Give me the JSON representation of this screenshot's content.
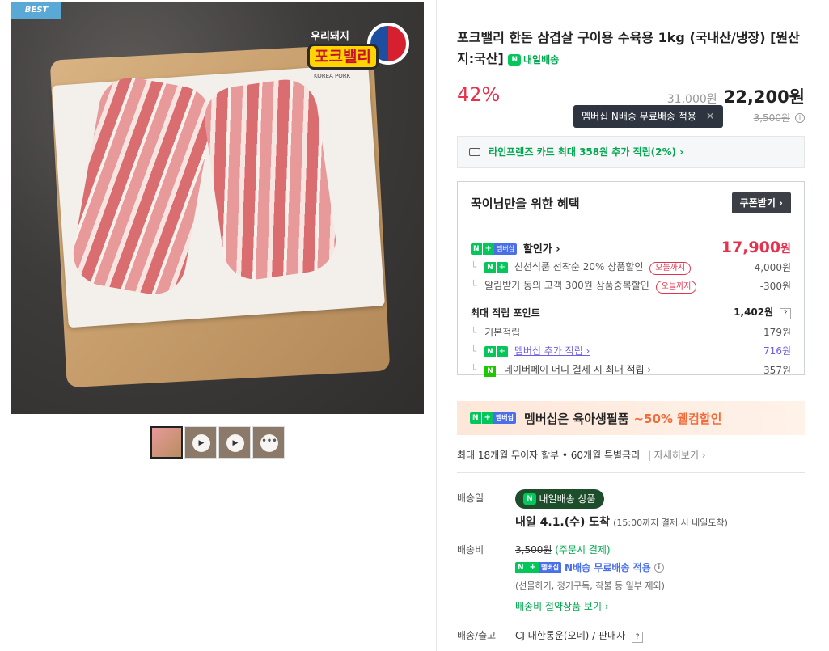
{
  "gallery": {
    "best_badge": "BEST",
    "logo": {
      "small_text": "우리돼지",
      "main_text": "포크밸리",
      "sub_text": "KOREA PORK"
    },
    "thumbnails": [
      {
        "type": "image",
        "active": true
      },
      {
        "type": "video",
        "icon": "play-icon"
      },
      {
        "type": "video",
        "icon": "play-icon"
      },
      {
        "type": "more",
        "icon": "more-icon"
      }
    ],
    "play_glyph": "▶",
    "more_glyph": "•••"
  },
  "product": {
    "title": "포크밸리 한돈 삼겹살 구이용 수육용 1kg (국내산/냉장) [원산지:국산]",
    "tomorrow_tag": "내일배송",
    "n_label": "N",
    "discount_rate": "42%",
    "original_price": "31,000원",
    "sale_price": "22,200원",
    "tooltip_text": "멤버십 N배송 무료배송 적용",
    "tooltip_close": "✕",
    "shipping_fee_strike": "3,500원",
    "info_glyph": "i"
  },
  "card_benefit": {
    "text": "라인프렌즈 카드 최대 358원 추가 적립(2%) ›"
  },
  "benefit_box": {
    "title": "꾹이님만을 위한 혜택",
    "coupon_button": "쿠폰받기 ›",
    "membership_badge": {
      "n": "N",
      "plus": "+",
      "txt": "멤버십"
    },
    "discount_label": "할인가 ›",
    "discount_price": "17,900",
    "price_unit": "원",
    "items": [
      {
        "label": "신선식품 선착순 20% 상품할인",
        "tag": "오늘까지",
        "value": "-4,000원"
      },
      {
        "label": "알림받기 동의 고객 300원 상품중복할인",
        "tag": "오늘까지",
        "value": "-300원"
      }
    ],
    "points_label": "최대 적립 포인트",
    "points_value": "1,402원",
    "q_glyph": "?",
    "point_items": [
      {
        "label": "기본적립",
        "value": "179원"
      },
      {
        "label": "멤버십 추가 적립 ›",
        "value": "716원"
      },
      {
        "label": "네이버페이 머니 결제 시 최대 적립 ›",
        "value": "357원"
      }
    ],
    "branch_glyph": "└"
  },
  "promo": {
    "text": "멤버십은 육아생필품",
    "highlight": "~50% 웰컴할인"
  },
  "installment": {
    "text": "최대 18개월 무이자 할부 • 60개월 특별금리",
    "more": "| 자세히보기 ›"
  },
  "delivery": {
    "date_label": "배송일",
    "badge": "내일배송 상품",
    "arrive_text": "내일 4.1.(수) 도착",
    "arrive_note": "(15:00까지 결제 시 내일도착)",
    "fee_label": "배송비",
    "fee_strike": "3,500원",
    "fee_note": "(주문시 결제)",
    "n_free_text": "N배송 무료배송 적용",
    "exclude_text": "(선물하기, 정기구독, 착불 등 일부 제외)",
    "save_link": "배송비 절약상품 보기 ›",
    "courier_label": "배송/출고",
    "courier_text": "CJ 대한통운(오네) / 판매자"
  },
  "colors": {
    "accent_red": "#e3334f",
    "naver_green": "#03c75a",
    "membership_blue": "#4b6fe8"
  }
}
